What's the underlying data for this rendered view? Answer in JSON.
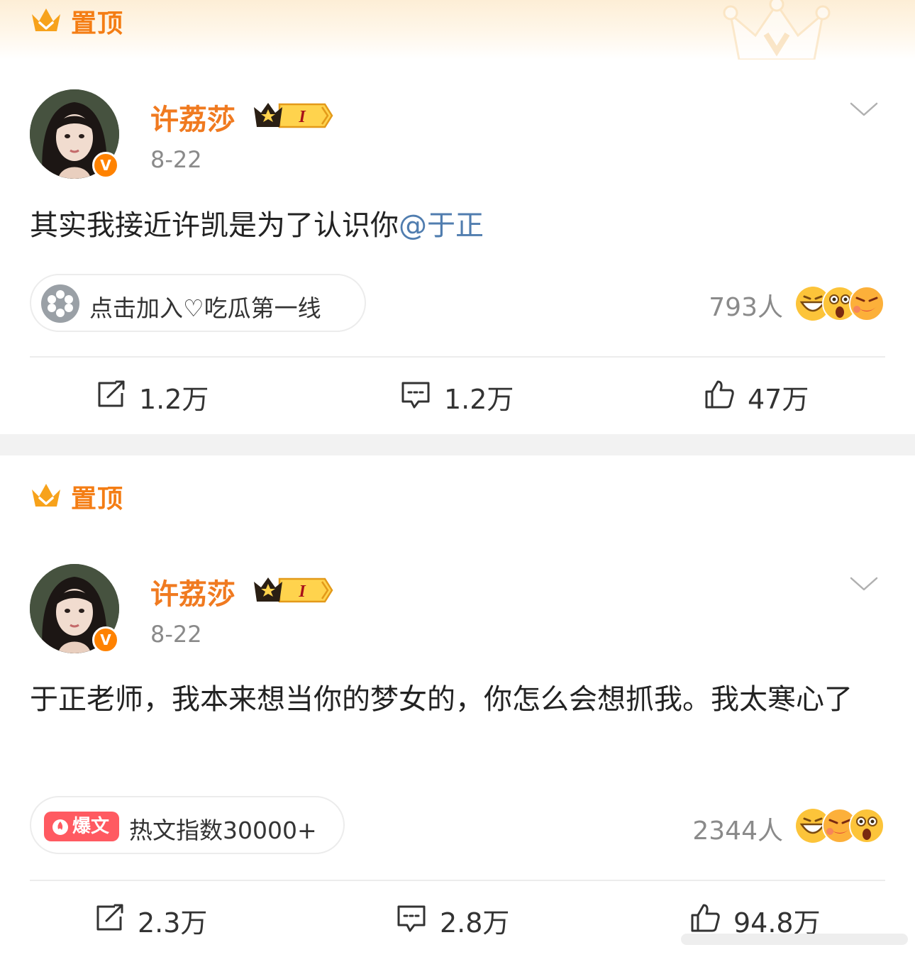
{
  "pinned_label": "置顶",
  "posts": [
    {
      "author": "许荔莎",
      "time": "8-22",
      "verified_mark": "V",
      "vip_level": "I",
      "content_text": "其实我接近许凯是为了认识你",
      "mention": "@于正",
      "chip": {
        "icon": "super-topic-icon",
        "text": "点击加入♡吃瓜第一线"
      },
      "reaction_count": "793人",
      "reaction_emojis": [
        "grin-emoji",
        "shocked-emoji",
        "angry-emoji"
      ],
      "actions": {
        "repost": "1.2万",
        "comment": "1.2万",
        "like": "47万"
      }
    },
    {
      "author": "许荔莎",
      "time": "8-22",
      "verified_mark": "V",
      "vip_level": "I",
      "content_text": "于正老师，我本来想当你的梦女的，你怎么会想抓我。我太寒心了",
      "chip": {
        "tag": "爆文",
        "text": "热文指数30000+"
      },
      "reaction_count": "2344人",
      "reaction_emojis": [
        "grin-emoji",
        "angry-emoji",
        "shocked-emoji"
      ],
      "actions": {
        "repost": "2.3万",
        "comment": "2.8万",
        "like": "94.8万"
      }
    }
  ],
  "colors": {
    "accent": "#f47d14",
    "username": "#f07a20",
    "mention": "#507daf",
    "hot_tag": "#ff5a61"
  }
}
